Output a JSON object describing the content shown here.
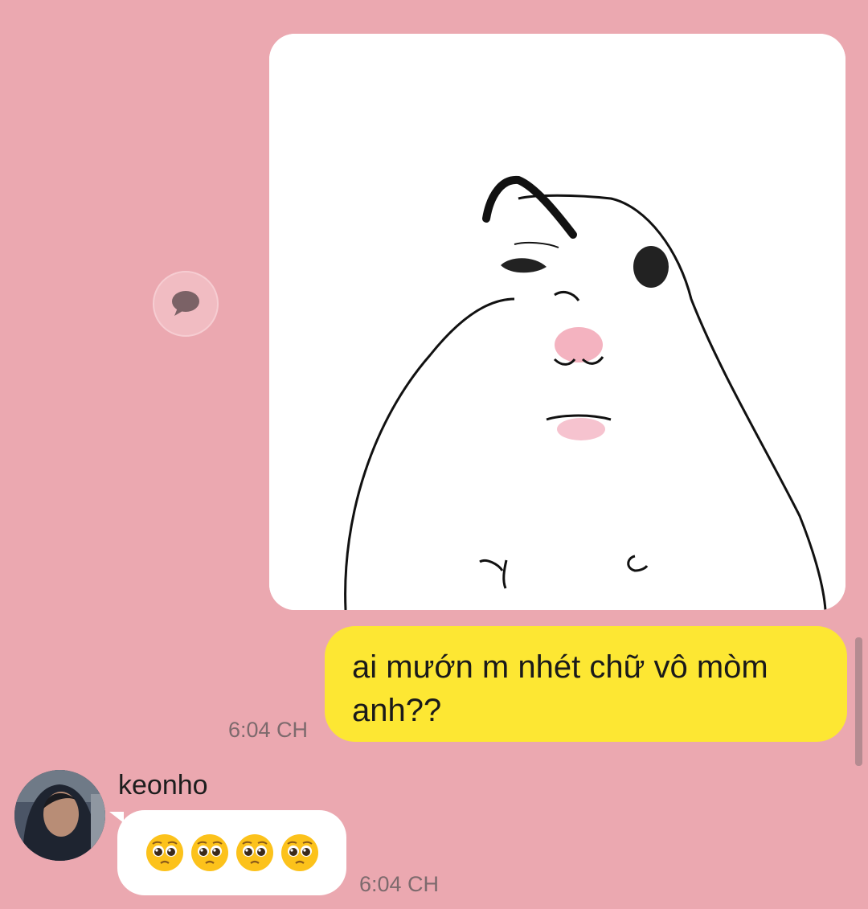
{
  "sent_message": {
    "text": "ai mướn m nhét chữ vô mòm anh??",
    "time": "6:04 CH"
  },
  "received_message": {
    "sender": "keonho",
    "emoji_count": 4,
    "emoji_name": "pleading-face",
    "time": "6:04 CH"
  },
  "colors": {
    "background": "#eba8b0",
    "sent_bubble": "#fde733",
    "received_bubble": "#ffffff"
  },
  "icons": {
    "reply": "speech-bubble-icon"
  }
}
